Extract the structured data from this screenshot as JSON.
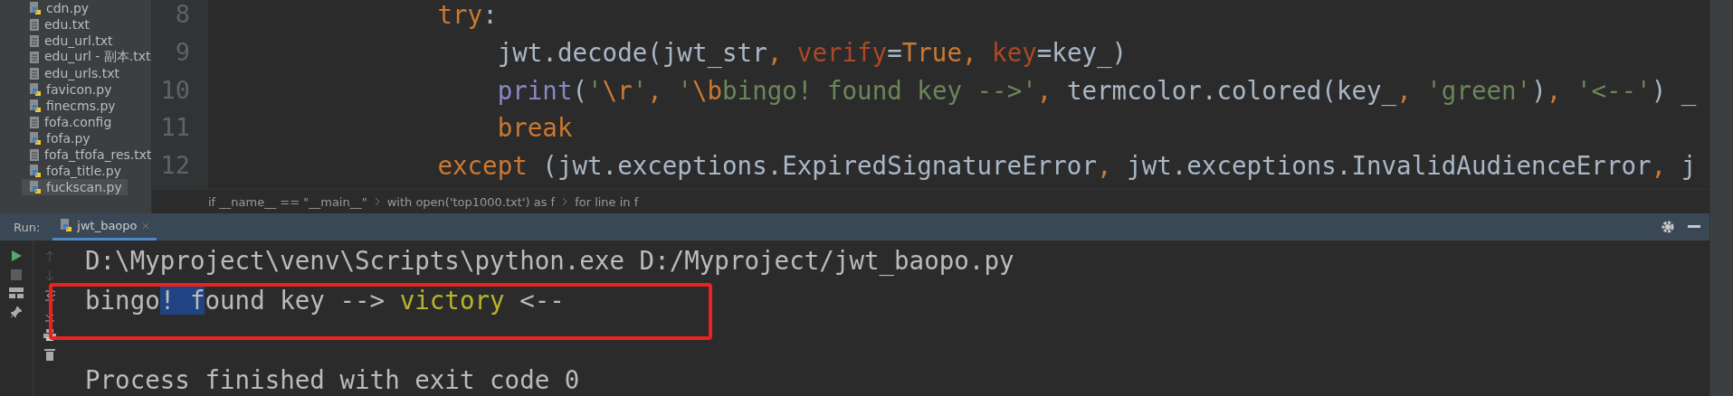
{
  "project_files": [
    {
      "name": "cdn.py",
      "kind": "python",
      "selected": false
    },
    {
      "name": "edu.txt",
      "kind": "text",
      "selected": false
    },
    {
      "name": "edu_url.txt",
      "kind": "text",
      "selected": false
    },
    {
      "name": "edu_url - 副本.txt",
      "kind": "text",
      "selected": false
    },
    {
      "name": "edu_urls.txt",
      "kind": "text",
      "selected": false
    },
    {
      "name": "favicon.py",
      "kind": "python",
      "selected": false
    },
    {
      "name": "finecms.py",
      "kind": "python",
      "selected": false
    },
    {
      "name": "fofa.config",
      "kind": "text",
      "selected": false
    },
    {
      "name": "fofa.py",
      "kind": "python",
      "selected": false
    },
    {
      "name": "fofa_tfofa_res.txt",
      "kind": "text",
      "selected": false
    },
    {
      "name": "fofa_title.py",
      "kind": "python",
      "selected": false
    },
    {
      "name": "fuckscan.py",
      "kind": "python",
      "selected": true
    }
  ],
  "editor": {
    "lines": [
      {
        "number": "8",
        "tokens": [
          {
            "text": "        try",
            "kind": "keyword"
          },
          {
            "text": ":",
            "kind": "plain"
          }
        ]
      },
      {
        "number": "9",
        "tokens": [
          {
            "text": "            jwt.decode(jwt_str",
            "kind": "plain"
          },
          {
            "text": ", ",
            "kind": "keyword"
          },
          {
            "text": "verify",
            "kind": "param"
          },
          {
            "text": "=",
            "kind": "plain"
          },
          {
            "text": "True",
            "kind": "keyword"
          },
          {
            "text": ", ",
            "kind": "keyword"
          },
          {
            "text": "key",
            "kind": "param"
          },
          {
            "text": "=key_)",
            "kind": "plain"
          }
        ]
      },
      {
        "number": "10",
        "tokens": [
          {
            "text": "            print",
            "kind": "builtin"
          },
          {
            "text": "(",
            "kind": "plain"
          },
          {
            "text": "'",
            "kind": "string"
          },
          {
            "text": "\\r",
            "kind": "escape"
          },
          {
            "text": "'",
            "kind": "string"
          },
          {
            "text": ", ",
            "kind": "keyword"
          },
          {
            "text": "'",
            "kind": "string"
          },
          {
            "text": "\\b",
            "kind": "escape"
          },
          {
            "text": "bingo! found key -->'",
            "kind": "string"
          },
          {
            "text": ", ",
            "kind": "keyword"
          },
          {
            "text": "termcolor.colored(key_",
            "kind": "plain"
          },
          {
            "text": ", ",
            "kind": "keyword"
          },
          {
            "text": "'green'",
            "kind": "string"
          },
          {
            "text": ")",
            "kind": "plain"
          },
          {
            "text": ", ",
            "kind": "keyword"
          },
          {
            "text": "'<--'",
            "kind": "string"
          },
          {
            "text": ") _",
            "kind": "plain"
          }
        ]
      },
      {
        "number": "11",
        "tokens": [
          {
            "text": "            break",
            "kind": "keyword"
          }
        ]
      },
      {
        "number": "12",
        "tokens": [
          {
            "text": "        except ",
            "kind": "keyword"
          },
          {
            "text": "(jwt.exceptions.ExpiredSignatureError",
            "kind": "plain"
          },
          {
            "text": ", ",
            "kind": "keyword"
          },
          {
            "text": "jwt.exceptions.InvalidAudienceError",
            "kind": "plain"
          },
          {
            "text": ", ",
            "kind": "keyword"
          },
          {
            "text": "j",
            "kind": "plain"
          }
        ]
      }
    ]
  },
  "breadcrumbs": [
    "if __name__ == \"__main__\"",
    "with open('top1000.txt') as f",
    "for line in f"
  ],
  "run_panel": {
    "label": "Run:",
    "tabs": [
      {
        "label": "jwt_baopo",
        "selected": true
      }
    ],
    "console": [
      {
        "kind": "output",
        "annotated": false,
        "segments": [
          {
            "text": "D:\\Myproject\\venv\\Scripts\\python.exe D:/Myproject/jwt_baopo.py",
            "selected": false
          }
        ]
      },
      {
        "kind": "output",
        "annotated": true,
        "segments": [
          {
            "text": "bingo",
            "selected": false
          },
          {
            "text": "! f",
            "selected": true
          },
          {
            "text": "ound key --> ",
            "selected": false
          },
          {
            "text": "victory",
            "selected": false,
            "color": "#b8b52a"
          },
          {
            "text": " <--",
            "selected": false
          }
        ]
      },
      {
        "kind": "blank"
      },
      {
        "kind": "output",
        "annotated": false,
        "segments": [
          {
            "text": "Process finished with exit code 0",
            "selected": false
          }
        ]
      }
    ]
  }
}
